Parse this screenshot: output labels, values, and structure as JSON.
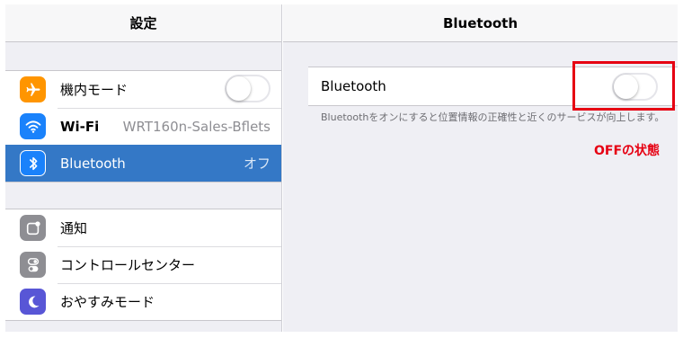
{
  "sidebar": {
    "title": "設定",
    "group1": [
      {
        "label": "機内モード",
        "icon": "airplane-icon",
        "toggle_on": false
      },
      {
        "label": "Wi-Fi",
        "icon": "wifi-icon",
        "value": "WRT160n-Sales-Bflets"
      },
      {
        "label": "Bluetooth",
        "icon": "bluetooth-icon",
        "value": "オフ",
        "selected": true
      }
    ],
    "group2": [
      {
        "label": "通知",
        "icon": "notification-icon"
      },
      {
        "label": "コントロールセンター",
        "icon": "control-center-icon"
      },
      {
        "label": "おやすみモード",
        "icon": "moon-icon"
      }
    ]
  },
  "detail": {
    "title": "Bluetooth",
    "bluetooth_row_label": "Bluetooth",
    "bluetooth_on": false,
    "footnote": "Bluetoothをオンにすると位置情報の正確性と近くのサービスが向上します。",
    "annotation": "OFFの状態"
  },
  "colors": {
    "selected_row": "#3478c6",
    "annotation_red": "#e60012",
    "airplane_icon": "#ff9500",
    "wifi_icon": "#1a82fb",
    "gray_icon": "#8e8e93",
    "moon_icon": "#5856d6"
  }
}
